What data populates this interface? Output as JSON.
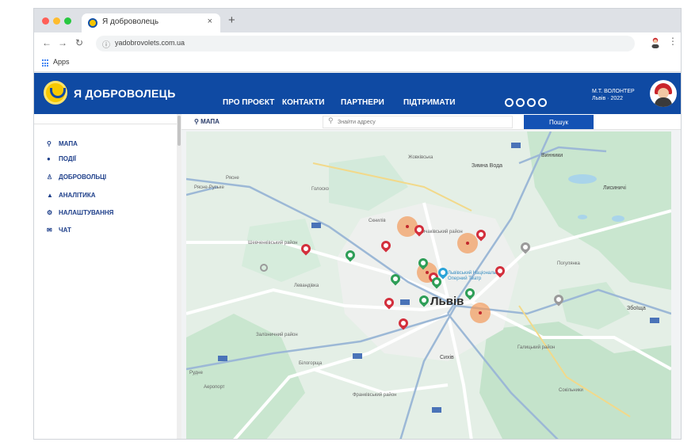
{
  "browser": {
    "tab_title": "Я доброволець",
    "tab_close": "×",
    "new_tab": "+",
    "nav": {
      "back": "←",
      "forward": "→",
      "reload": "↻"
    },
    "url": "yadobrovolets.com.ua",
    "bookmarks": {
      "apps_label": "Apps"
    }
  },
  "app": {
    "name": "Я ДОБРОВОЛЕЦЬ",
    "menu": [
      "ПРО ПРОЄКТ",
      "КОНТАКТИ",
      "ПАРТНЕРИ",
      "ПІДТРИМАТИ"
    ],
    "user": {
      "line1": "М.Т. ВОЛОНТЕР",
      "line2": "Львів · 2022"
    },
    "brand_colors": {
      "header": "#0f4aa3",
      "logo": "#f7c800"
    }
  },
  "sidebar": {
    "items": [
      {
        "label": "МАПА",
        "icon": "map-pin-icon",
        "glyph": "⚲"
      },
      {
        "label": "ПОДІЇ",
        "icon": "location-icon",
        "glyph": "●"
      },
      {
        "label": "ДОБРОВОЛЬЦІ",
        "icon": "people-icon",
        "glyph": "♙"
      },
      {
        "label": "АНАЛІТИКА",
        "icon": "analytics-icon",
        "glyph": "▲"
      },
      {
        "label": "НАЛАШТУВАННЯ",
        "icon": "settings-icon",
        "glyph": "⚙"
      },
      {
        "label": "ЧАТ",
        "icon": "chat-icon",
        "glyph": "✉"
      }
    ]
  },
  "toolbar": {
    "crumb": "МАПА",
    "search_placeholder": "Знайти адресу",
    "search_button": "Пошук"
  },
  "map": {
    "labels": {
      "city": "Львів",
      "zymna": "Зимна Вода",
      "sykhiv": "Сихів",
      "sokilnyky": "Сокільники",
      "rudne": "Рудне",
      "lysynychi": "Лисиничі",
      "vynnyky": "Винники",
      "zboishcha": "Збоїща",
      "zaliznychnyi": "Залізничний район",
      "frankivskyi": "Франківський район",
      "shevchenkivskyi": "Шевченківський район",
      "halytskyi": "Галицький район",
      "lychakiv": "Личаківський район",
      "theatre": "Львівський Національний Оперний Театр",
      "holosko": "Голоско",
      "ryasne": "Рясне",
      "bilohorshcha": "Білогорща",
      "riasne_ru": "Рясне-Руське",
      "pohulianka": "Погулянка",
      "sknyliv": "Скнилів",
      "levandivka": "Левандівка",
      "zhovkva_rd": "Жовківська",
      "airport": "Аеропорт"
    },
    "marker_colors": {
      "red": "#d32f3c",
      "green": "#2e9e57",
      "gray": "#9a9a9a",
      "blue": "#2aa3d8",
      "cluster": "#f39c60"
    }
  }
}
